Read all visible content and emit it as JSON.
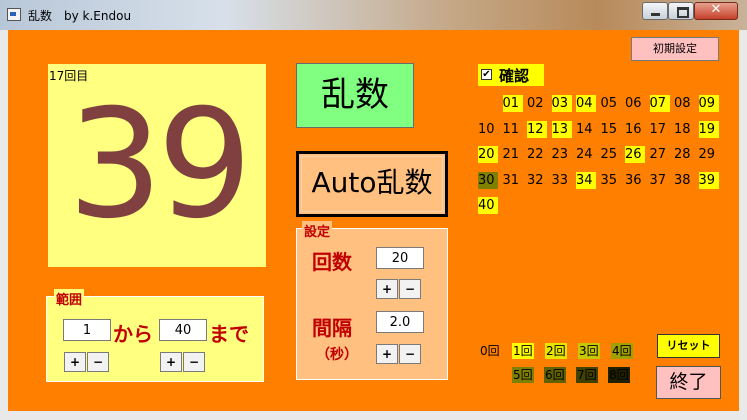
{
  "window": {
    "title": "乱数　by k.Endou",
    "close_label": "✕"
  },
  "counter": {
    "label": "17回目",
    "value": "39"
  },
  "buttons": {
    "ransu": "乱数",
    "auto": "Auto乱数",
    "init": "初期設定",
    "reset": "リセット",
    "exit": "終了"
  },
  "settings": {
    "legend": "設定",
    "count_label": "回数",
    "count_value": "20",
    "interval_label": "間隔",
    "interval_value": "2.0",
    "unit_label": "（秒）",
    "plus": "+",
    "minus": "−"
  },
  "range": {
    "legend": "範囲",
    "from_value": "1",
    "from_label": "から",
    "to_value": "40",
    "to_label": "まで"
  },
  "confirm": {
    "label": "確認",
    "checked": true,
    "check_mark": "✔"
  },
  "numbers": [
    {
      "n": "01",
      "s": "y"
    },
    {
      "n": "02",
      "s": ""
    },
    {
      "n": "03",
      "s": "y"
    },
    {
      "n": "04",
      "s": "y"
    },
    {
      "n": "05",
      "s": ""
    },
    {
      "n": "06",
      "s": ""
    },
    {
      "n": "07",
      "s": "y"
    },
    {
      "n": "08",
      "s": ""
    },
    {
      "n": "09",
      "s": "y"
    },
    {
      "n": "10",
      "s": ""
    },
    {
      "n": "11",
      "s": ""
    },
    {
      "n": "12",
      "s": "y"
    },
    {
      "n": "13",
      "s": "y"
    },
    {
      "n": "14",
      "s": ""
    },
    {
      "n": "15",
      "s": ""
    },
    {
      "n": "16",
      "s": ""
    },
    {
      "n": "17",
      "s": ""
    },
    {
      "n": "18",
      "s": ""
    },
    {
      "n": "19",
      "s": "y"
    },
    {
      "n": "20",
      "s": "y"
    },
    {
      "n": "21",
      "s": ""
    },
    {
      "n": "22",
      "s": ""
    },
    {
      "n": "23",
      "s": ""
    },
    {
      "n": "24",
      "s": ""
    },
    {
      "n": "25",
      "s": ""
    },
    {
      "n": "26",
      "s": "y"
    },
    {
      "n": "27",
      "s": ""
    },
    {
      "n": "28",
      "s": ""
    },
    {
      "n": "29",
      "s": ""
    },
    {
      "n": "30",
      "s": "o"
    },
    {
      "n": "31",
      "s": ""
    },
    {
      "n": "32",
      "s": ""
    },
    {
      "n": "33",
      "s": ""
    },
    {
      "n": "34",
      "s": "y"
    },
    {
      "n": "35",
      "s": ""
    },
    {
      "n": "36",
      "s": ""
    },
    {
      "n": "37",
      "s": ""
    },
    {
      "n": "38",
      "s": ""
    },
    {
      "n": "39",
      "s": "y"
    },
    {
      "n": "40",
      "s": "y"
    }
  ],
  "legend_counts": [
    {
      "label": "0回",
      "bg": "#ff8000"
    },
    {
      "label": "1回",
      "bg": "#ffff00"
    },
    {
      "label": "2回",
      "bg": "#e6e600"
    },
    {
      "label": "3回",
      "bg": "#c8c800"
    },
    {
      "label": "4回",
      "bg": "#a0a000"
    },
    {
      "label": "5回",
      "bg": "#808000"
    },
    {
      "label": "6回",
      "bg": "#606000"
    },
    {
      "label": "7回",
      "bg": "#404000"
    },
    {
      "label": "8回",
      "bg": "#202000"
    }
  ],
  "colors": {
    "client": "#ff8000",
    "panel_yellow": "#ffff80",
    "number_text": "#80403f",
    "highlight": "#ffff00",
    "olive": "#808000"
  }
}
